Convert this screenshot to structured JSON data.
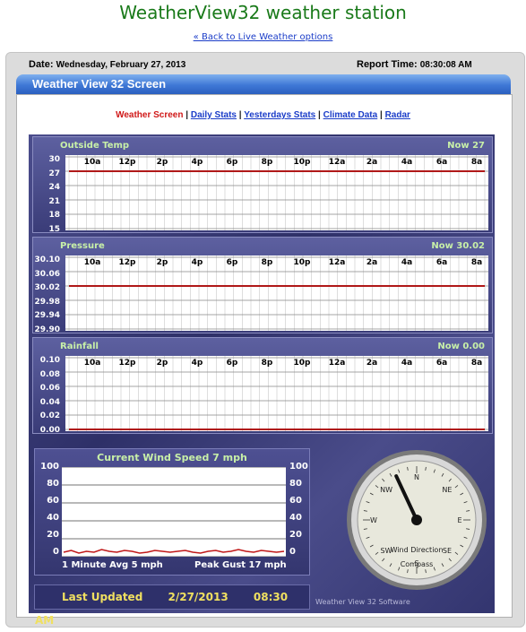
{
  "page": {
    "title": "WeatherView32 weather station",
    "back_link": "« Back to Live Weather options"
  },
  "report": {
    "date_label": "Date:",
    "date_value": "Wednesday, February 27, 2013",
    "time_label": "Report Time:",
    "time_value": "08:30:08 AM",
    "screen_title": "Weather View 32 Screen"
  },
  "nav": {
    "current": "Weather Screen",
    "links": [
      "Daily Stats",
      "Yesterdays Stats",
      "Climate Data",
      "Radar"
    ],
    "separator": "|"
  },
  "time_axis": [
    "10a",
    "12p",
    "2p",
    "4p",
    "6p",
    "8p",
    "10p",
    "12a",
    "2a",
    "4a",
    "6a",
    "8a"
  ],
  "graphs": [
    {
      "title": "Outside Temp",
      "now": "Now 27",
      "y_ticks": [
        "30",
        "27",
        "24",
        "21",
        "18",
        "15"
      ],
      "y_range": [
        15,
        30
      ],
      "value": 27,
      "line_color": "#b01818"
    },
    {
      "title": "Pressure",
      "now": "Now 30.02",
      "y_ticks": [
        "30.10",
        "30.06",
        "30.02",
        "29.98",
        "29.94",
        "29.90"
      ],
      "y_range": [
        29.9,
        30.1
      ],
      "value": 30.02,
      "line_color": "#b01818"
    },
    {
      "title": "Rainfall",
      "now": "Now 0.00",
      "y_ticks": [
        "0.10",
        "0.08",
        "0.06",
        "0.04",
        "0.02",
        "0.00"
      ],
      "y_range": [
        0.0,
        0.1
      ],
      "value": 0.0,
      "line_color": "#b01818"
    }
  ],
  "wind": {
    "title": "Current Wind Speed 7 mph",
    "y_ticks": [
      "100",
      "80",
      "60",
      "40",
      "20",
      "0"
    ],
    "y_range": [
      0,
      100
    ],
    "avg_label": "1 Minute Avg 5 mph",
    "gust_label": "Peak Gust 17 mph",
    "series": [
      5,
      7,
      4,
      6,
      5,
      8,
      6,
      5,
      7,
      6,
      4,
      5,
      7,
      6,
      5,
      6,
      7,
      5,
      4,
      6,
      7,
      5,
      6,
      8,
      6,
      5,
      7,
      6,
      5,
      6
    ]
  },
  "compass": {
    "labels": [
      "N",
      "NE",
      "E",
      "SE",
      "S",
      "SW",
      "W",
      "NW"
    ],
    "caption_1": "Wind Direction",
    "caption_2": "Compass",
    "needle_deg": 335
  },
  "footer": {
    "last_updated_label": "Last Updated",
    "date": "2/27/2013",
    "time": "08:30 AM",
    "software": "Weather View 32 Software"
  },
  "colors": {
    "title_green": "#1a7a1a",
    "link_blue": "#1a3cc8",
    "active_red": "#d01818",
    "graph_label_green": "#c8f0a8"
  }
}
